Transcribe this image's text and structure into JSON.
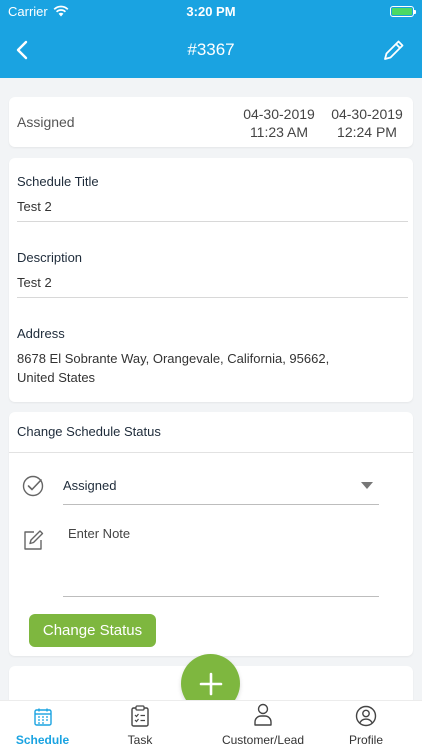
{
  "status_bar": {
    "carrier": "Carrier",
    "time": "3:20 PM"
  },
  "nav": {
    "title": "#3367",
    "back_icon": "chevron-left-icon",
    "edit_icon": "pencil-icon"
  },
  "summary": {
    "status": "Assigned",
    "start": {
      "date": "04-30-2019",
      "time": "11:23 AM"
    },
    "end": {
      "date": "04-30-2019",
      "time": "12:24 PM"
    }
  },
  "details": {
    "title_label": "Schedule Title",
    "title_value": "Test 2",
    "description_label": "Description",
    "description_value": "Test 2",
    "address_label": "Address",
    "address_line1": "8678 El Sobrante Way, Orangevale, California, 95662,",
    "address_line2": "United States"
  },
  "change_status": {
    "heading": "Change Schedule Status",
    "selected": "Assigned",
    "note_placeholder": "Enter Note",
    "button_label": "Change Status"
  },
  "tabs": [
    {
      "label": "Schedule",
      "icon": "calendar-icon",
      "active": true
    },
    {
      "label": "Task",
      "icon": "clipboard-icon",
      "active": false
    },
    {
      "label": "Customer/Lead",
      "icon": "person-icon",
      "active": false
    },
    {
      "label": "Profile",
      "icon": "user-circle-icon",
      "active": false
    }
  ],
  "colors": {
    "primary": "#1aa3e1",
    "accent": "#7eb73f"
  }
}
